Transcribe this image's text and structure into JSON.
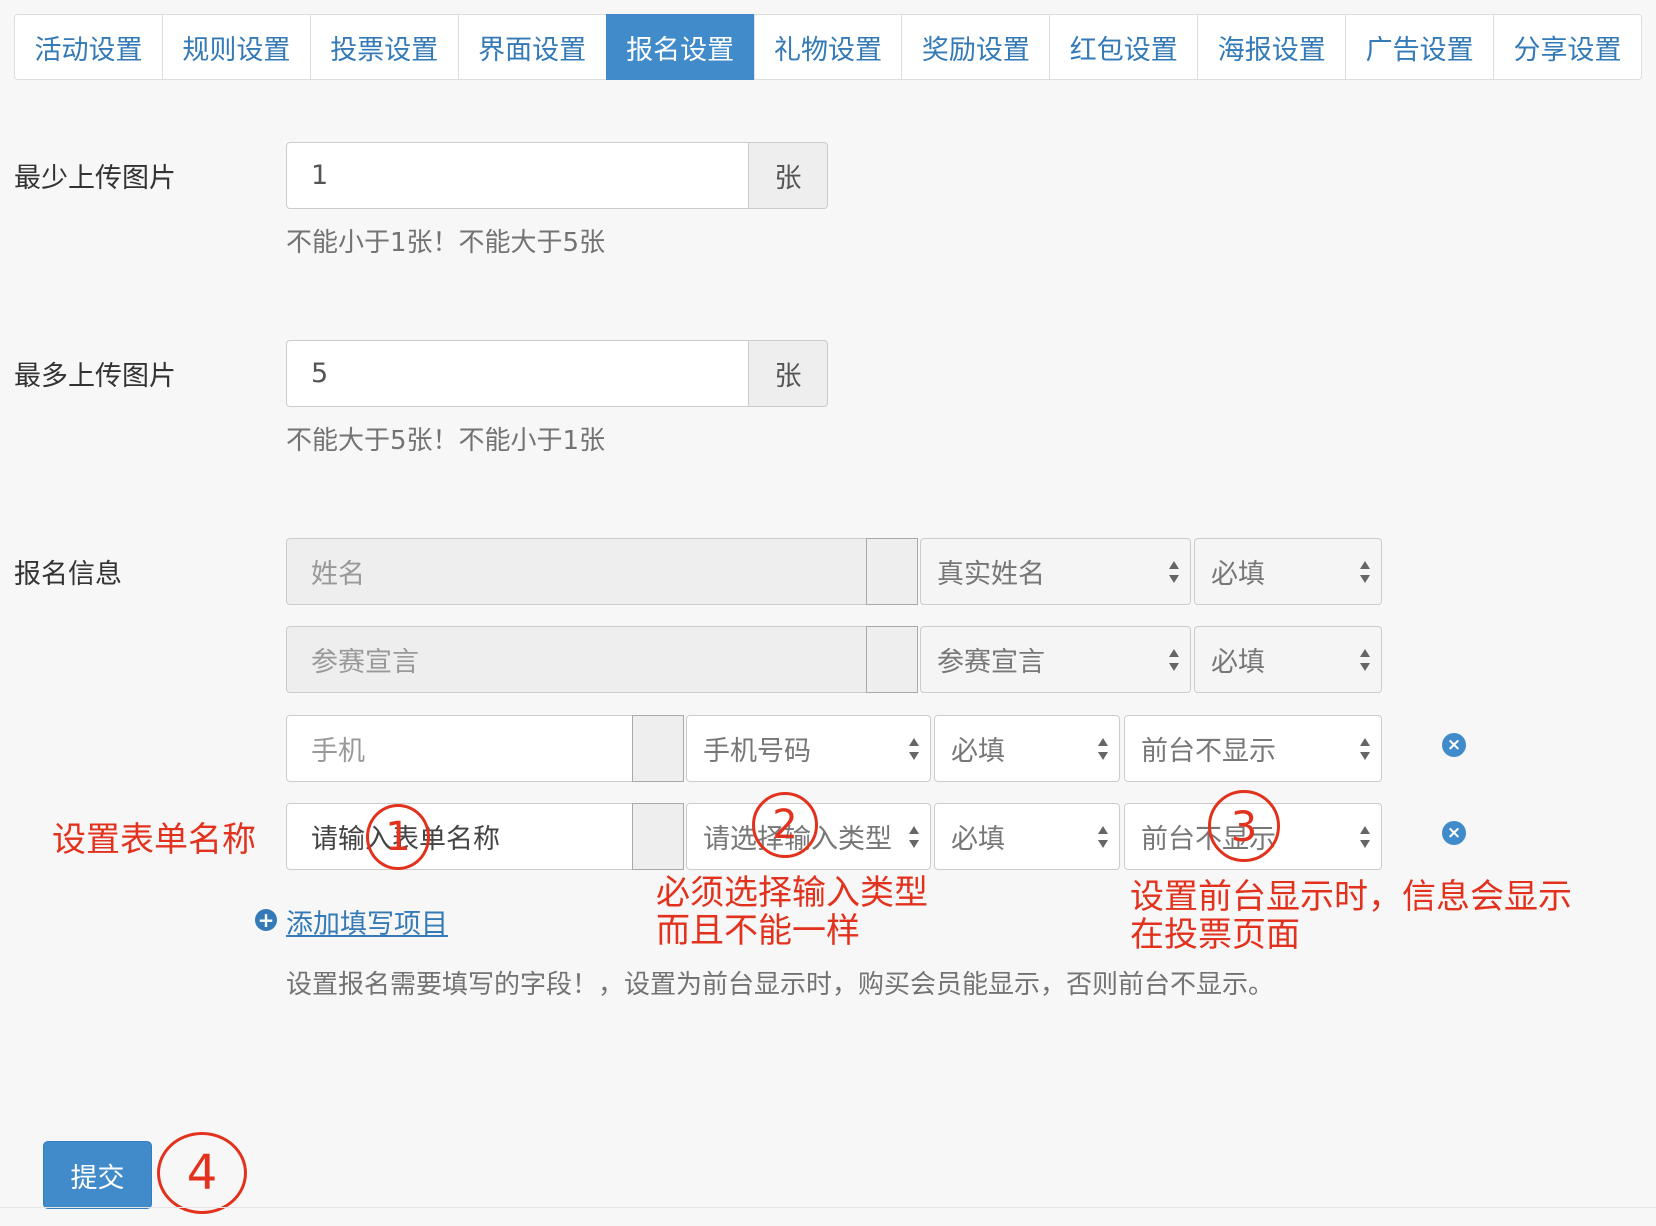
{
  "tabs": [
    {
      "label": "活动设置",
      "active": false
    },
    {
      "label": "规则设置",
      "active": false
    },
    {
      "label": "投票设置",
      "active": false
    },
    {
      "label": "界面设置",
      "active": false
    },
    {
      "label": "报名设置",
      "active": true
    },
    {
      "label": "礼物设置",
      "active": false
    },
    {
      "label": "奖励设置",
      "active": false
    },
    {
      "label": "红包设置",
      "active": false
    },
    {
      "label": "海报设置",
      "active": false
    },
    {
      "label": "广告设置",
      "active": false
    },
    {
      "label": "分享设置",
      "active": false
    }
  ],
  "min_upload": {
    "label": "最少上传图片",
    "value": "1",
    "unit": "张",
    "help": "不能小于1张！不能大于5张"
  },
  "max_upload": {
    "label": "最多上传图片",
    "value": "5",
    "unit": "张",
    "help": "不能大于5张！不能小于1张"
  },
  "signup": {
    "label": "报名信息",
    "fixed_rows": [
      {
        "name": "姓名",
        "type": "真实姓名",
        "required": "必填"
      },
      {
        "name": "参赛宣言",
        "type": "参赛宣言",
        "required": "必填"
      }
    ],
    "custom_rows": [
      {
        "name": "手机",
        "type": "手机号码",
        "required": "必填",
        "display": "前台不显示",
        "name_placeholder": "",
        "type_placeholder": ""
      },
      {
        "name": "",
        "type": "",
        "required": "必填",
        "display": "前台不显示",
        "name_placeholder": "请输入表单名称",
        "type_placeholder": "请选择输入类型"
      }
    ],
    "add_link": "添加填写项目",
    "help": "设置报名需要填写的字段！，设置为前台显示时，购买会员能显示，否则前台不显示。"
  },
  "annotations": {
    "set_form_name": "设置表单名称",
    "type_note_line1": "必须选择输入类型",
    "type_note_line2": "而且不能一样",
    "display_note_line1": "设置前台显示时，信息会显示",
    "display_note_line2": "在投票页面",
    "circle1": "1",
    "circle2": "2",
    "circle3": "3",
    "circle4": "4"
  },
  "submit_label": "提交",
  "colors": {
    "primary": "#428bca",
    "annotation_red": "#e2321e",
    "link": "#337ab7"
  }
}
